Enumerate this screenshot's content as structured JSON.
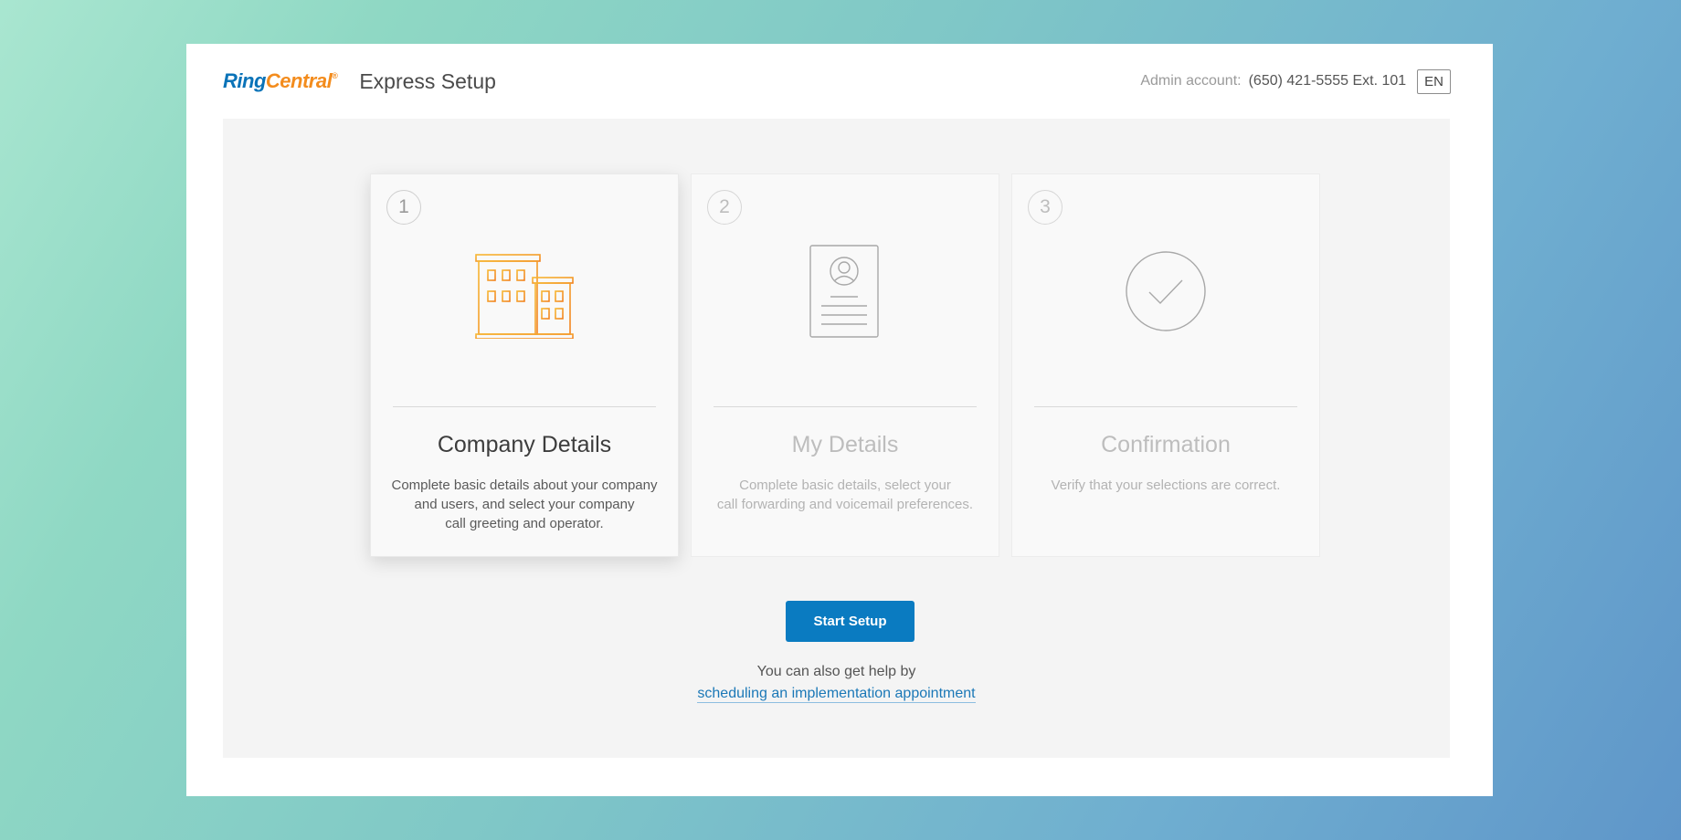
{
  "header": {
    "logo_ring": "Ring",
    "logo_central": "Central",
    "logo_mark": "®",
    "app_title": "Express Setup",
    "admin_label": "Admin account:",
    "admin_number": "(650) 421-5555 Ext. 101",
    "language": "EN"
  },
  "steps": [
    {
      "number": "1",
      "title": "Company Details",
      "description": "Complete basic details about your company\nand users, and select your company\ncall greeting and operator.",
      "icon": "building-icon",
      "active": true
    },
    {
      "number": "2",
      "title": "My Details",
      "description": "Complete basic details, select your\ncall forwarding and voicemail preferences.",
      "icon": "profile-card-icon",
      "active": false
    },
    {
      "number": "3",
      "title": "Confirmation",
      "description": "Verify that your selections are correct.",
      "icon": "checkmark-circle-icon",
      "active": false
    }
  ],
  "actions": {
    "start_label": "Start Setup",
    "help_text": "You can also get help by",
    "help_link": "scheduling an implementation appointment"
  },
  "colors": {
    "brand_blue": "#0a73b8",
    "brand_orange": "#f38c1d",
    "button_blue": "#0a7bc1",
    "icon_orange": "#f5a623"
  }
}
